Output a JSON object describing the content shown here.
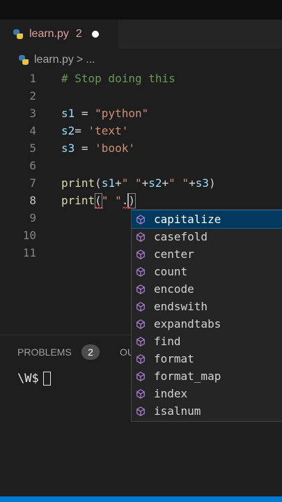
{
  "editor": {
    "tab": {
      "filename": "learn.py",
      "problem_count": "2"
    },
    "breadcrumb": {
      "file": "learn.py",
      "separator": ">",
      "more": "..."
    },
    "line_numbers": [
      "1",
      "2",
      "3",
      "4",
      "5",
      "6",
      "7",
      "8",
      "9",
      "10",
      "11"
    ],
    "active_line": "8",
    "code": {
      "line1": "# Stop doing this",
      "line3_var": "s1",
      "line3_op": " = ",
      "line3_str": "\"python\"",
      "line4_var": "s2",
      "line4_op": "= ",
      "line4_str": "'text'",
      "line5_var": "s3",
      "line5_op": " = ",
      "line5_str": "'book'",
      "line7_fn": "print",
      "line7_p1": "(",
      "line7_v1": "s1",
      "line7_p2": "+",
      "line7_s1": "\" \"",
      "line7_p3": "+",
      "line7_v2": "s2",
      "line7_p4": "+",
      "line7_s2": "\" \"",
      "line7_p5": "+",
      "line7_v3": "s3",
      "line7_p6": ")",
      "line8_fn": "print",
      "line8_p1": "(",
      "line8_s1": "\" \"",
      "line8_p2": ".",
      "line8_p3": ")"
    },
    "squiggle_color": "#f14c4c"
  },
  "suggestions": {
    "selected_index": 0,
    "items": [
      "capitalize",
      "casefold",
      "center",
      "count",
      "encode",
      "endswith",
      "expandtabs",
      "find",
      "format",
      "format_map",
      "index",
      "isalnum"
    ],
    "icon": "method-cube-icon",
    "icon_color": "#b180d7"
  },
  "panel": {
    "problems_label": "PROBLEMS",
    "problems_count": "2",
    "output_label_partial": "OU",
    "terminal_prompt": "\\W$"
  },
  "colors": {
    "statusbar": "#007acc",
    "accent": "#0e639c"
  }
}
